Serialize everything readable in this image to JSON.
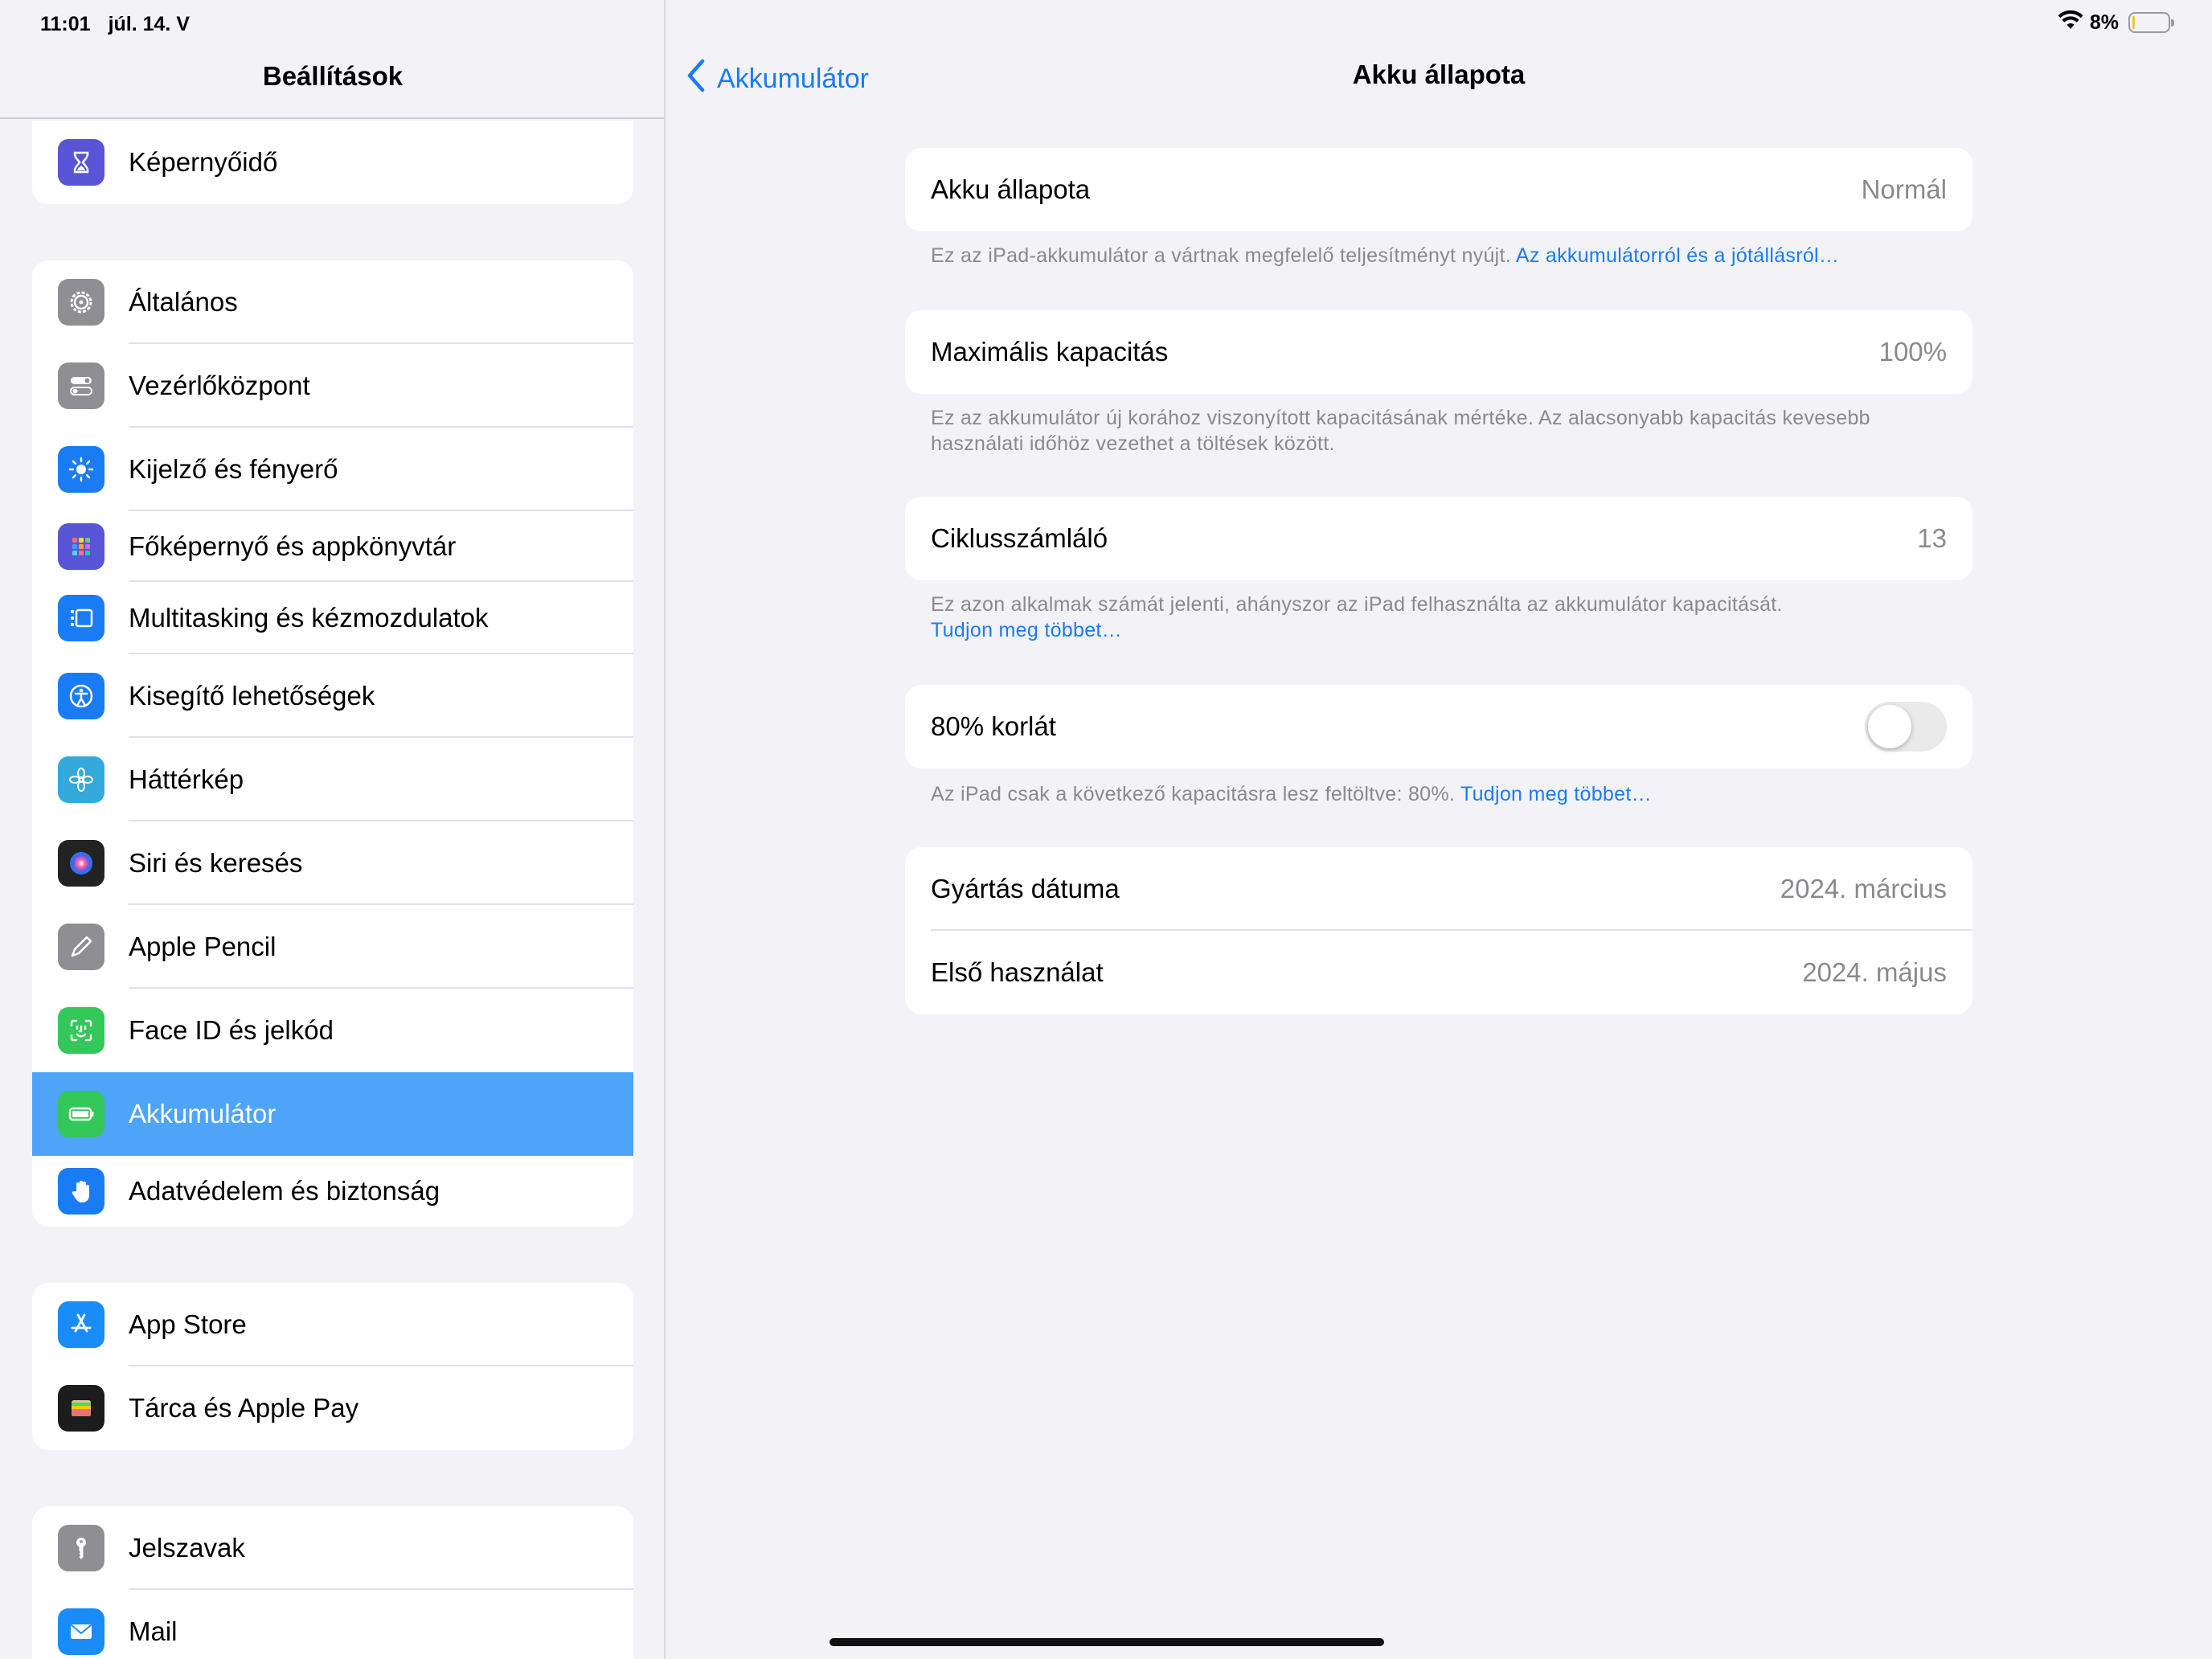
{
  "status_bar": {
    "time": "11:01",
    "date": "júl. 14. V",
    "battery_percent": "8%",
    "battery_level": 0.08
  },
  "sidebar": {
    "title": "Beállítások",
    "groups": [
      {
        "items": [
          {
            "label": "Képernyőidő",
            "icon": "hourglass-icon",
            "color": "#5856d6"
          }
        ]
      },
      {
        "items": [
          {
            "label": "Általános",
            "icon": "gear-icon",
            "color": "#8e8e93"
          },
          {
            "label": "Vezérlőközpont",
            "icon": "switches-icon",
            "color": "#8e8e93"
          },
          {
            "label": "Kijelző és fényerő",
            "icon": "sun-icon",
            "color": "#1a7cf5"
          },
          {
            "label": "Főképernyő és appkönyvtár",
            "icon": "app-grid-icon",
            "color": "#5856d6"
          },
          {
            "label": "Multitasking és kézmozdulatok",
            "icon": "multitasking-icon",
            "color": "#1a7cf5"
          },
          {
            "label": "Kisegítő lehetőségek",
            "icon": "accessibility-icon",
            "color": "#1a7cf5"
          },
          {
            "label": "Háttérkép",
            "icon": "flower-icon",
            "color": "#34aadc"
          },
          {
            "label": "Siri és keresés",
            "icon": "siri-icon",
            "color": "#222222"
          },
          {
            "label": "Apple Pencil",
            "icon": "pencil-icon",
            "color": "#8e8e93"
          },
          {
            "label": "Face ID és jelkód",
            "icon": "face-id-icon",
            "color": "#34c759"
          },
          {
            "label": "Akkumulátor",
            "icon": "battery-icon",
            "color": "#34c759",
            "selected": true
          },
          {
            "label": "Adatvédelem és biztonság",
            "icon": "hand-icon",
            "color": "#1a7cf5"
          }
        ]
      },
      {
        "items": [
          {
            "label": "App Store",
            "icon": "app-store-icon",
            "color": "#1a8cf7"
          },
          {
            "label": "Tárca és Apple Pay",
            "icon": "wallet-icon",
            "color": "#1c1c1e"
          }
        ]
      },
      {
        "items": [
          {
            "label": "Jelszavak",
            "icon": "key-icon",
            "color": "#8e8e93"
          },
          {
            "label": "Mail",
            "icon": "mail-icon",
            "color": "#1a8cf7"
          }
        ]
      }
    ]
  },
  "detail": {
    "back_label": "Akkumulátor",
    "title": "Akku állapota",
    "battery_health": {
      "label": "Akku állapota",
      "value": "Normál",
      "footnote": "Ez az iPad-akkumulátor a vártnak megfelelő teljesítményt nyújt.",
      "footnote_link": "Az akkumulátorról és a jótállásról…"
    },
    "max_capacity": {
      "label": "Maximális kapacitás",
      "value": "100%",
      "footnote_line1": "Ez az akkumulátor új korához viszonyított kapacitásának mértéke. Az alacsonyabb kapacitás kevesebb",
      "footnote_line2": "használati időhöz vezethet a töltések között."
    },
    "cycle_count": {
      "label": "Ciklusszámláló",
      "value": "13",
      "footnote": "Ez azon alkalmak számát jelenti, ahányszor az iPad felhasználta az akkumulátor kapacitását.",
      "footnote_link": "Tudjon meg többet…"
    },
    "limit_80": {
      "label": "80% korlát",
      "enabled": false,
      "footnote": "Az iPad csak a következő kapacitásra lesz feltöltve: 80%.",
      "footnote_link": "Tudjon meg többet…"
    },
    "dates": {
      "manufacture_label": "Gyártás dátuma",
      "manufacture_value": "2024. március",
      "first_use_label": "Első használat",
      "first_use_value": "2024. május"
    }
  }
}
